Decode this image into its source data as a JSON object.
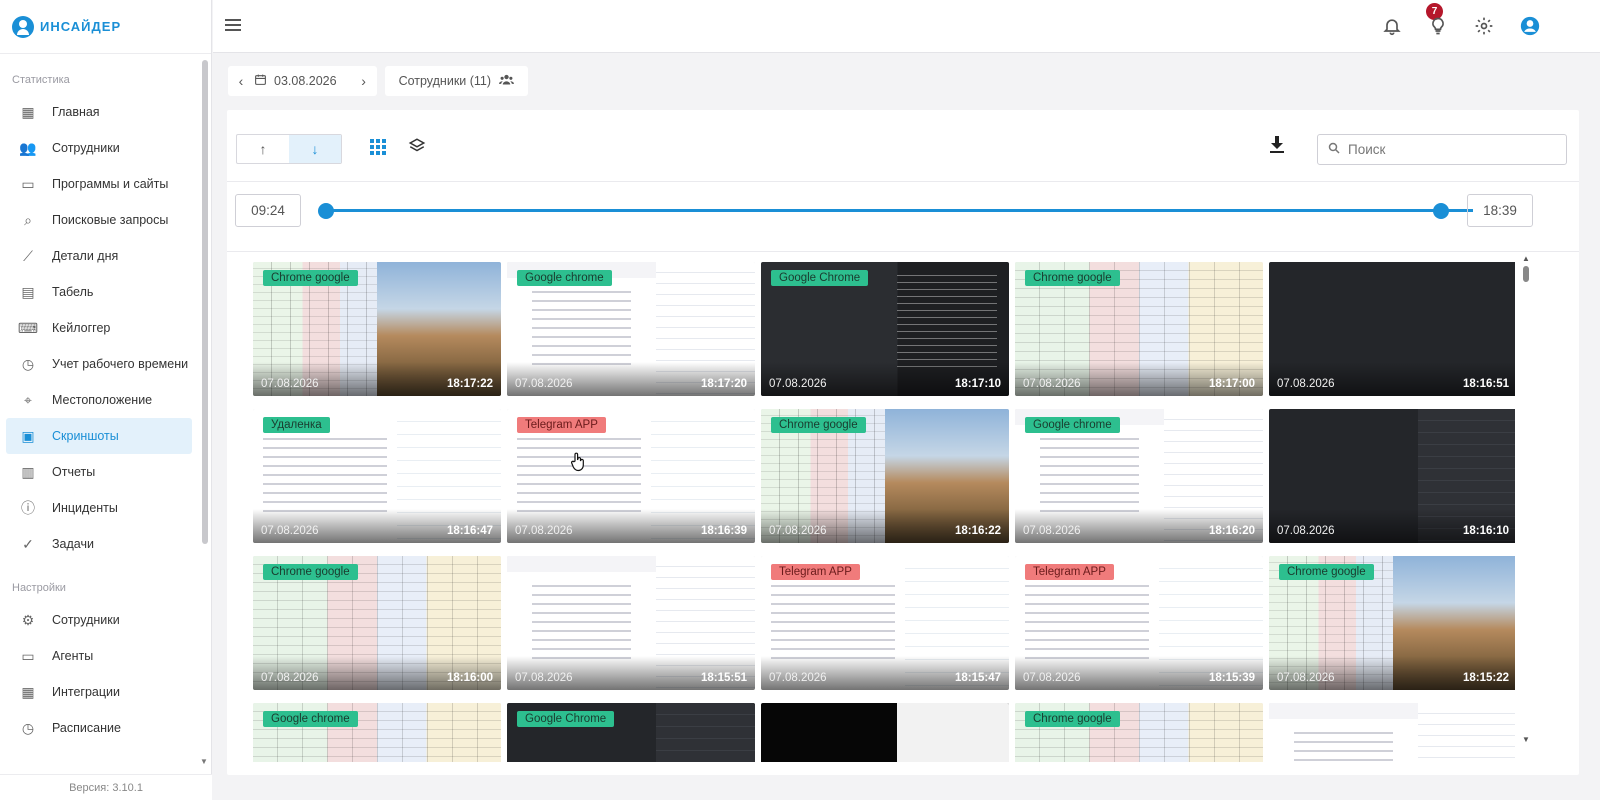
{
  "brand": {
    "name": "ИНСАЙДЕР"
  },
  "sidebar": {
    "sections": [
      {
        "title": "Статистика",
        "items": [
          {
            "label": "Главная",
            "icon": "dashboard-icon"
          },
          {
            "label": "Сотрудники",
            "icon": "users-icon"
          },
          {
            "label": "Программы и сайты",
            "icon": "window-icon"
          },
          {
            "label": "Поисковые запросы",
            "icon": "search-icon"
          },
          {
            "label": "Детали дня",
            "icon": "trend-icon"
          },
          {
            "label": "Табель",
            "icon": "document-icon"
          },
          {
            "label": "Кейлоггер",
            "icon": "keyboard-icon"
          },
          {
            "label": "Учет рабочего времени",
            "icon": "clock-calendar-icon"
          },
          {
            "label": "Местоположение",
            "icon": "location-icon"
          },
          {
            "label": "Скриншоты",
            "icon": "screenshot-icon",
            "active": true
          },
          {
            "label": "Отчеты",
            "icon": "report-icon"
          },
          {
            "label": "Инциденты",
            "icon": "alert-icon"
          },
          {
            "label": "Задачи",
            "icon": "check-circle-icon"
          }
        ]
      },
      {
        "title": "Настройки",
        "items": [
          {
            "label": "Сотрудники",
            "icon": "user-settings-icon"
          },
          {
            "label": "Агенты",
            "icon": "agent-icon"
          },
          {
            "label": "Интеграции",
            "icon": "integration-icon"
          },
          {
            "label": "Расписание",
            "icon": "schedule-icon"
          }
        ]
      }
    ],
    "version": "Версия: 3.10.1"
  },
  "topbar": {
    "notifications_count": "7"
  },
  "filters": {
    "date": "03.08.2026",
    "employees": "Сотрудники (11)"
  },
  "toolbar": {
    "search_placeholder": "Поиск"
  },
  "timeline": {
    "start": "09:24",
    "end": "18:39"
  },
  "colors": {
    "accent": "#1a8fd6",
    "tag_green": "#2dbf8f",
    "tag_red": "#f07b7b",
    "badge": "#b5172b"
  },
  "screenshots": [
    {
      "tag": "Chrome google",
      "tag_color": "green",
      "date": "07.08.2026",
      "time": "18:17:22",
      "style": "sheet-land"
    },
    {
      "tag": "Google chrome",
      "tag_color": "green",
      "date": "07.08.2026",
      "time": "18:17:20",
      "style": "web"
    },
    {
      "tag": "Google Chrome",
      "tag_color": "green",
      "date": "07.08.2026",
      "time": "18:17:10",
      "style": "darkcode"
    },
    {
      "tag": "Chrome google",
      "tag_color": "green",
      "date": "07.08.2026",
      "time": "18:17:00",
      "style": "sheet"
    },
    {
      "tag": "",
      "tag_color": "green",
      "date": "07.08.2026",
      "time": "18:16:51",
      "style": "dark"
    },
    {
      "tag": "Удаленка",
      "tag_color": "green",
      "date": "07.08.2026",
      "time": "18:16:47",
      "style": "chat"
    },
    {
      "tag": "Telegram APP",
      "tag_color": "red",
      "date": "07.08.2026",
      "time": "18:16:39",
      "style": "chat"
    },
    {
      "tag": "Chrome google",
      "tag_color": "green",
      "date": "07.08.2026",
      "time": "18:16:22",
      "style": "sheet-land"
    },
    {
      "tag": "Google chrome",
      "tag_color": "green",
      "date": "07.08.2026",
      "time": "18:16:20",
      "style": "web"
    },
    {
      "tag": "",
      "tag_color": "green",
      "date": "07.08.2026",
      "time": "18:16:10",
      "style": "darklist"
    },
    {
      "tag": "Chrome google",
      "tag_color": "green",
      "date": "07.08.2026",
      "time": "18:16:00",
      "style": "sheet"
    },
    {
      "tag": "",
      "tag_color": "green",
      "date": "07.08.2026",
      "time": "18:15:51",
      "style": "web"
    },
    {
      "tag": "Telegram APP",
      "tag_color": "red",
      "date": "07.08.2026",
      "time": "18:15:47",
      "style": "chat"
    },
    {
      "tag": "Telegram APP",
      "tag_color": "red",
      "date": "07.08.2026",
      "time": "18:15:39",
      "style": "chat"
    },
    {
      "tag": "Chrome google",
      "tag_color": "green",
      "date": "07.08.2026",
      "time": "18:15:22",
      "style": "sheet-land"
    },
    {
      "tag": "Google chrome",
      "tag_color": "green",
      "date": "",
      "time": "",
      "style": "sheet"
    },
    {
      "tag": "Google Chrome",
      "tag_color": "green",
      "date": "",
      "time": "",
      "style": "darklist"
    },
    {
      "tag": "",
      "tag_color": "green",
      "date": "",
      "time": "",
      "style": "black"
    },
    {
      "tag": "Chrome google",
      "tag_color": "green",
      "date": "",
      "time": "",
      "style": "sheet"
    },
    {
      "tag": "",
      "tag_color": "green",
      "date": "",
      "time": "",
      "style": "web"
    }
  ]
}
